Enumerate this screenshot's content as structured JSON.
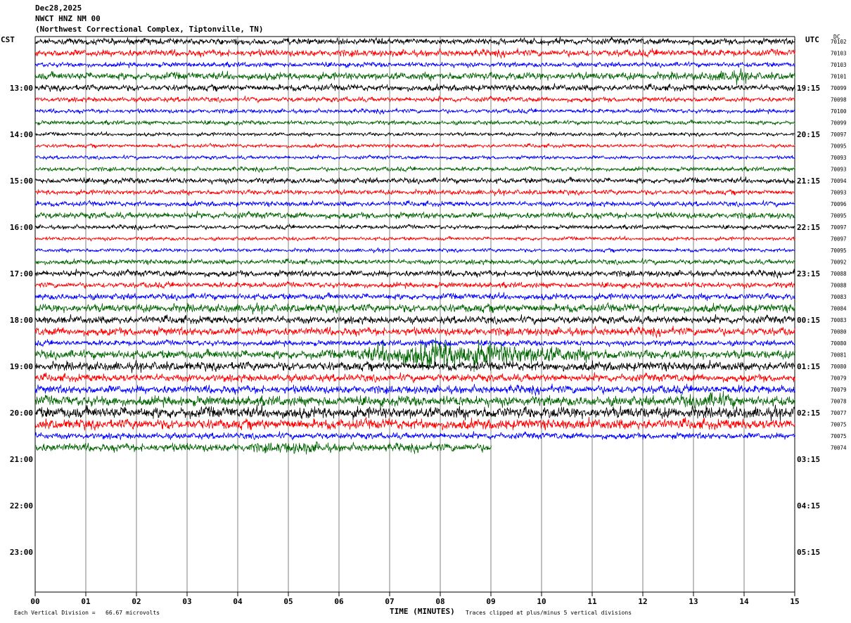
{
  "header": {
    "date": "Dec28,2025",
    "station": "NWCT HNZ NM 00",
    "location": "(Northwest Correctional Complex, Tiptonville, TN)"
  },
  "left_zone": "CST",
  "right_zone": "UTC",
  "dc_label": "DC",
  "footer": {
    "scale_note": "Each Vertical Division =   66.67 microvolts",
    "xlabel": "TIME (MINUTES)",
    "clip_note": "Traces clipped at plus/minus 5 vertical divisions"
  },
  "colors": {
    "cycle": [
      "#000000",
      "#ff0000",
      "#0000ff",
      "#006400"
    ],
    "grid": "#808080"
  },
  "chart_data": {
    "type": "line",
    "title": "NWCT HNZ NM 00",
    "xlabel": "TIME (MINUTES)",
    "x_ticks": [
      "00",
      "01",
      "02",
      "03",
      "04",
      "05",
      "06",
      "07",
      "08",
      "09",
      "10",
      "11",
      "12",
      "13",
      "14",
      "15"
    ],
    "xlim": [
      0,
      15
    ],
    "left_time_labels": [
      "13:00",
      "14:00",
      "15:00",
      "16:00",
      "17:00",
      "18:00",
      "19:00",
      "20:00",
      "21:00",
      "22:00",
      "23:00"
    ],
    "right_time_labels": [
      "19:15",
      "20:15",
      "21:15",
      "22:15",
      "23:15",
      "00:15",
      "01:15",
      "02:15",
      "03:15",
      "04:15",
      "05:15"
    ],
    "traces_per_hour": 4,
    "total_rows": 48,
    "dc_offsets": [
      70102,
      70103,
      70103,
      70101,
      70099,
      70098,
      70100,
      70099,
      70097,
      70095,
      70093,
      70093,
      70094,
      70093,
      70096,
      70095,
      70097,
      70097,
      70095,
      70092,
      70088,
      70088,
      70083,
      70084,
      70083,
      70080,
      70080,
      70081,
      70080,
      70079,
      70079,
      70078,
      70077,
      70075,
      70075,
      70074
    ],
    "amplitude_rows": [
      1.0,
      1.1,
      0.8,
      1.2,
      1.0,
      0.8,
      0.7,
      0.7,
      0.6,
      0.6,
      0.6,
      0.7,
      0.9,
      0.8,
      0.8,
      1.0,
      0.7,
      0.6,
      0.6,
      0.8,
      1.0,
      0.9,
      1.0,
      1.3,
      1.2,
      1.3,
      0.9,
      1.4,
      1.4,
      1.2,
      1.3,
      1.6,
      1.8,
      1.6,
      1.0,
      1.3
    ],
    "last_trace_end_minute": 9.0,
    "events": [
      {
        "row": 27,
        "start_minute": 6.0,
        "end_minute": 11.5,
        "peak_minute": 7.9,
        "amplitude": 3.5
      },
      {
        "row": 26,
        "start_minute": 7.5,
        "end_minute": 8.5,
        "peak_minute": 7.9,
        "amplitude": 1.8
      },
      {
        "row": 31,
        "start_minute": 12.5,
        "end_minute": 14.0,
        "peak_minute": 13.5,
        "amplitude": 1.8
      },
      {
        "row": 3,
        "start_minute": 13.2,
        "end_minute": 14.3,
        "peak_minute": 13.8,
        "amplitude": 1.7
      },
      {
        "row": 35,
        "start_minute": 4.0,
        "end_minute": 6.0,
        "peak_minute": 5.3,
        "amplitude": 1.6
      }
    ]
  }
}
